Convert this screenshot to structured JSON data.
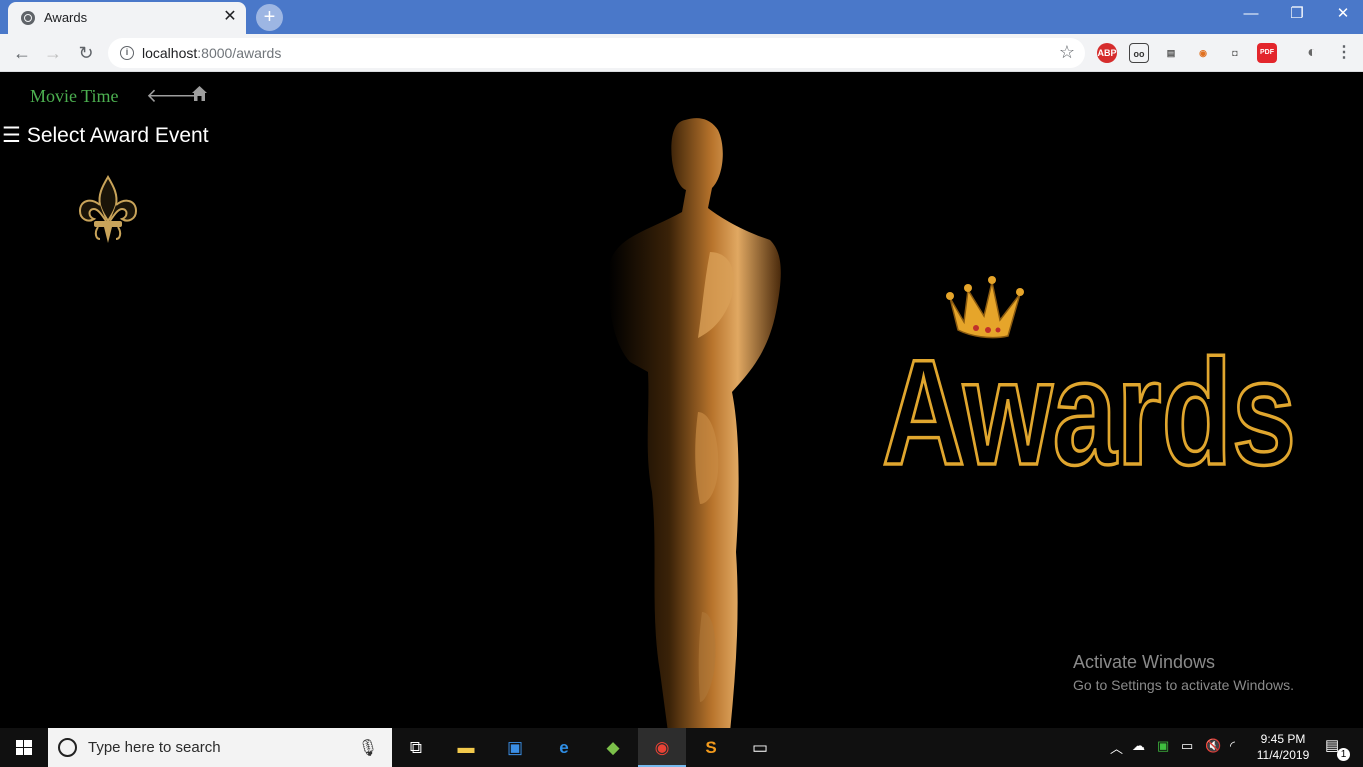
{
  "browser": {
    "tab_title": "Awards",
    "tab_close": "✕",
    "new_tab": "+",
    "url_host": "localhost",
    "url_rest": ":8000/awards",
    "window_controls": [
      "—",
      "❐",
      "✕"
    ],
    "extensions": [
      "ABP",
      "oo",
      "▤",
      "◉",
      "◘",
      "PDF",
      "◐",
      "⋮"
    ]
  },
  "nav": {
    "brand": "Movie Time",
    "back_glyph": "🡐"
  },
  "sidebar": {
    "menu_glyph": "☰",
    "label": "Select Award Event"
  },
  "hero": {
    "logo_text": "Awards"
  },
  "watermark": {
    "line1": "Activate Windows",
    "line2": "Go to Settings to activate Windows."
  },
  "taskbar": {
    "search_placeholder": "Type here to search",
    "time": "9:45 PM",
    "date": "11/4/2019",
    "notification_count": "1"
  },
  "colors": {
    "brand": "#4caf50",
    "gold": "#e0a62e",
    "tab_strip": "#4a78c9"
  }
}
